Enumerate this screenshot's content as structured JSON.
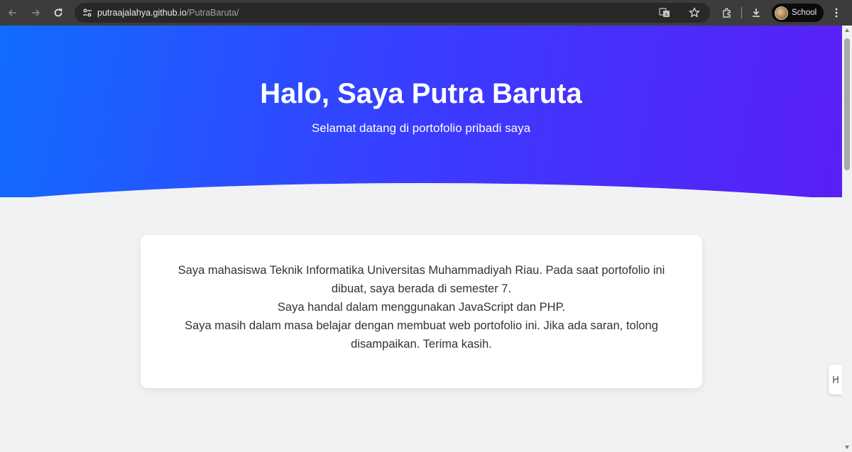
{
  "browser": {
    "url_host": "putraajalahya.github.io",
    "url_path": "/PutraBaruta/",
    "profile_name": "School",
    "icons": [
      "back-icon",
      "forward-icon",
      "reload-icon",
      "site-info-icon",
      "translate-icon",
      "bookmark-star-icon",
      "extensions-icon",
      "download-icon",
      "avatar",
      "menu-kebab-icon"
    ]
  },
  "hero": {
    "title": "Halo, Saya Putra Baruta",
    "subtitle": "Selamat datang di portofolio pribadi saya",
    "gradient_start": "#116cff",
    "gradient_end": "#5a1ff5"
  },
  "about": {
    "paragraph_1": "Saya mahasiswa Teknik Informatika Universitas Muhammadiyah Riau. Pada saat portofolio ini dibuat, saya berada di semester 7.",
    "paragraph_2": "Saya handal dalam menggunakan JavaScript dan PHP.",
    "paragraph_3": "Saya masih dalam masa belajar dengan membuat web portofolio ini. Jika ada saran, tolong disampaikan. Terima kasih."
  }
}
